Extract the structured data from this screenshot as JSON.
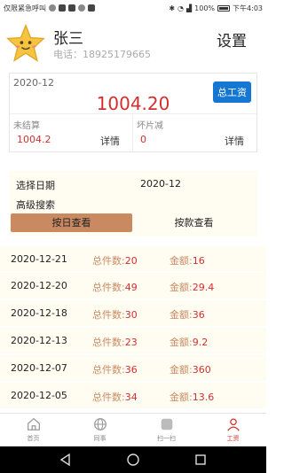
{
  "status_bar": {
    "left_text": "仅限紧急呼叫",
    "battery": "100%",
    "time": "下午4:03"
  },
  "profile": {
    "name": "张三",
    "phone_label": "电话：",
    "phone": "18925179665",
    "settings": "设置"
  },
  "summary": {
    "month": "2020-12",
    "total": "1004.20",
    "total_button": "总工资",
    "unsettled_label": "未结算",
    "unsettled_value": "1004.2",
    "unsettled_detail": "详情",
    "damage_label": "坏片减",
    "damage_value": "0",
    "damage_detail": "详情"
  },
  "filters": {
    "date_label": "选择日期",
    "date_value": "2020-12",
    "advanced_search": "高级搜索",
    "tab_by_day": "按日查看",
    "tab_by_item": "按款查看"
  },
  "records": [
    {
      "date": "2020-12-21",
      "count_label": "总件数:",
      "count": "20",
      "amount_label": "金额:",
      "amount": "16"
    },
    {
      "date": "2020-12-20",
      "count_label": "总件数:",
      "count": "49",
      "amount_label": "金额:",
      "amount": "29.4"
    },
    {
      "date": "2020-12-18",
      "count_label": "总件数:",
      "count": "30",
      "amount_label": "金额:",
      "amount": "36"
    },
    {
      "date": "2020-12-13",
      "count_label": "总件数:",
      "count": "23",
      "amount_label": "金额:",
      "amount": "9.2"
    },
    {
      "date": "2020-12-07",
      "count_label": "总件数:",
      "count": "36",
      "amount_label": "金额:",
      "amount": "360"
    },
    {
      "date": "2020-12-05",
      "count_label": "总件数:",
      "count": "34",
      "amount_label": "金额:",
      "amount": "13.6"
    }
  ],
  "tabbar": {
    "home": "首页",
    "colleagues": "同事",
    "scan": "扫一扫",
    "salary": "工资"
  },
  "colors": {
    "accent_red": "#d32f2f",
    "accent_brown": "#c98a62",
    "button_blue": "#1677d2",
    "cream_bg": "#fffcf2"
  }
}
